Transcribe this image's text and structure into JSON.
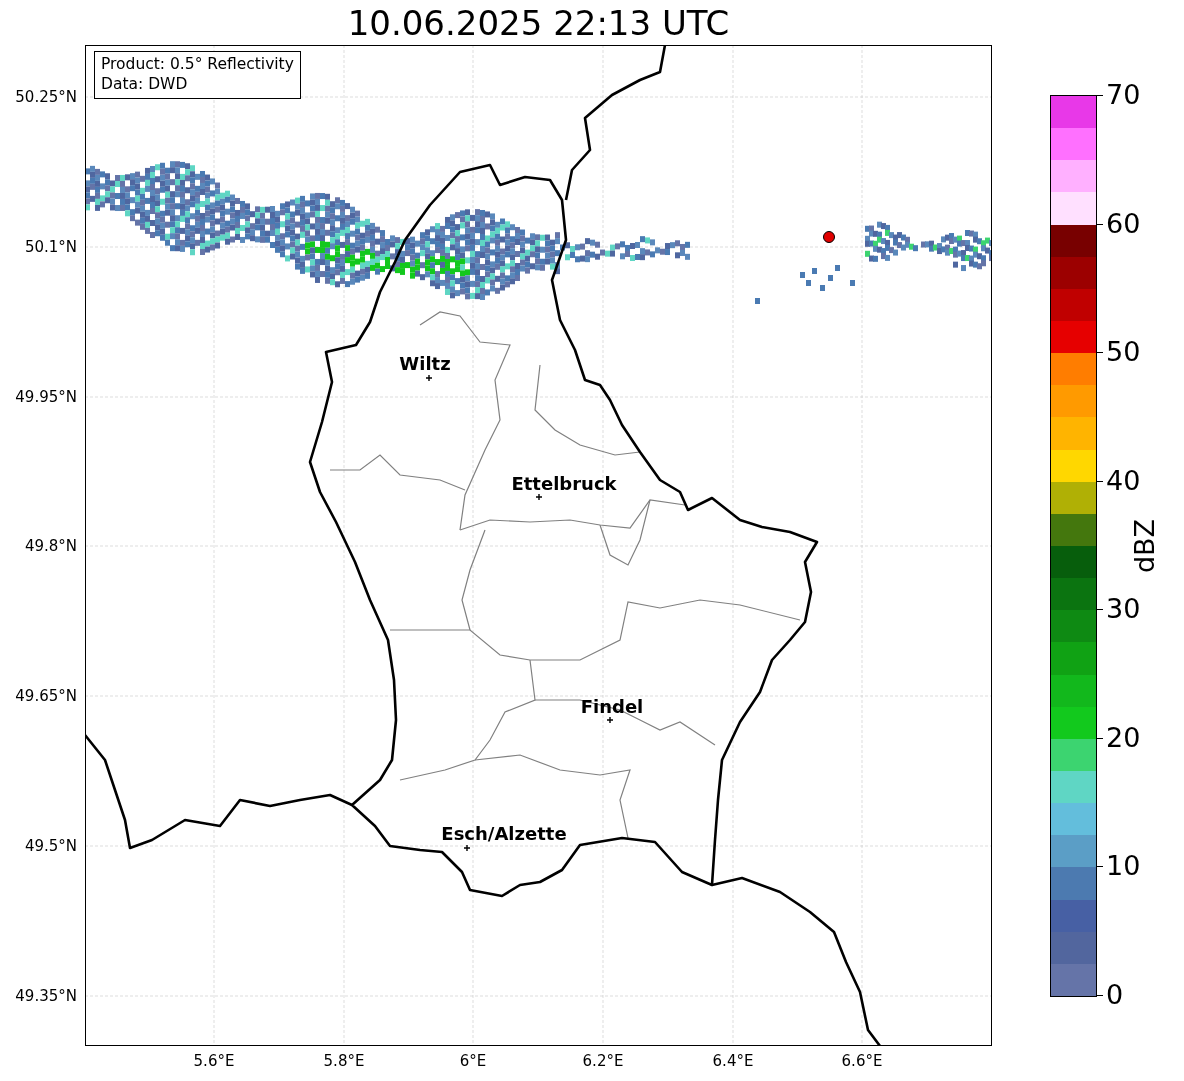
{
  "title": "10.06.2025 22:13 UTC",
  "info_box": [
    "Product: 0.5° Reflectivity",
    "Data: DWD"
  ],
  "cities": [
    {
      "name": "Wiltz"
    },
    {
      "name": "Ettelbruck"
    },
    {
      "name": "Findel"
    },
    {
      "name": "Esch/Alzette"
    }
  ],
  "y_ticks": [
    "50.25°N",
    "50.1°N",
    "49.95°N",
    "49.8°N",
    "49.65°N",
    "49.5°N",
    "49.35°N"
  ],
  "x_ticks": [
    "5.6°E",
    "5.8°E",
    "6°E",
    "6.2°E",
    "6.4°E",
    "6.6°E"
  ],
  "colorbar": {
    "label": "dBZ",
    "ticks": [
      "70",
      "60",
      "50",
      "40",
      "30",
      "20",
      "10",
      "0"
    ],
    "segments": [
      {
        "color": "#6574a8"
      },
      {
        "color": "#52669e"
      },
      {
        "color": "#4760a4"
      },
      {
        "color": "#4c7ab0"
      },
      {
        "color": "#5b9ec6"
      },
      {
        "color": "#63bedc"
      },
      {
        "color": "#5fd6c4"
      },
      {
        "color": "#3cd470"
      },
      {
        "color": "#12c91d"
      },
      {
        "color": "#12b81c"
      },
      {
        "color": "#10a214"
      },
      {
        "color": "#0e8a13"
      },
      {
        "color": "#0b7410"
      },
      {
        "color": "#075e0c"
      },
      {
        "color": "#44770d"
      },
      {
        "color": "#b0b005"
      },
      {
        "color": "#ffd700"
      },
      {
        "color": "#ffb400"
      },
      {
        "color": "#ff9a00"
      },
      {
        "color": "#ff7d00"
      },
      {
        "color": "#e60000"
      },
      {
        "color": "#c00000"
      },
      {
        "color": "#9c0000"
      },
      {
        "color": "#780000"
      },
      {
        "color": "#ffe0ff"
      },
      {
        "color": "#ffb0ff"
      },
      {
        "color": "#ff70ff"
      },
      {
        "color": "#e838e8"
      }
    ]
  }
}
